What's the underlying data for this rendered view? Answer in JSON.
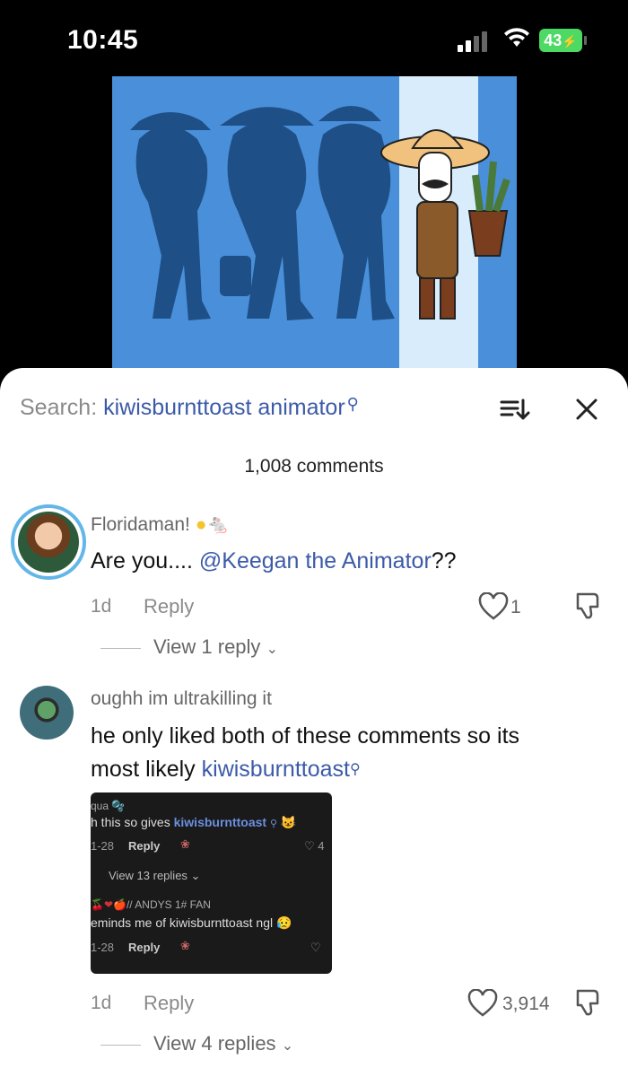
{
  "status_bar": {
    "time": "10:45",
    "battery": "43"
  },
  "sheet": {
    "search_prefix": "Search: ",
    "search_keyword": "kiwisburnttoast animator",
    "comments_count": "1,008 comments"
  },
  "comments": [
    {
      "username": "Floridaman!",
      "text_prefix": "Are you.... ",
      "mention": "@Keegan the Animator",
      "text_suffix": "??",
      "age": "1d",
      "reply_label": "Reply",
      "likes": "1",
      "view_replies": "View 1 reply"
    },
    {
      "username": "oughh im ultrakilling it",
      "text_line1": "he only liked both of these comments so its",
      "text_line2": "most likely ",
      "mention": "kiwisburnttoast",
      "age": "1d",
      "reply_label": "Reply",
      "likes": "3,914",
      "view_replies": "View 4 replies",
      "embed": {
        "user1": "qua",
        "comment1_prefix": "h this so gives ",
        "comment1_keyword": "kiwisburnttoast",
        "date1": "1-28",
        "reply1": "Reply",
        "likes1": "4",
        "view_replies": "View 13 replies",
        "user2": "// ANDYS 1# FAN",
        "comment2": "eminds me of kiwisburnttoast ngl",
        "date2": "1-28",
        "reply2": "Reply"
      }
    }
  ],
  "colors": {
    "accent": "#3b5aa8",
    "video_bg": "#4a8fd9",
    "avatar_ring": "#62b6e8",
    "battery": "#4cd964"
  }
}
